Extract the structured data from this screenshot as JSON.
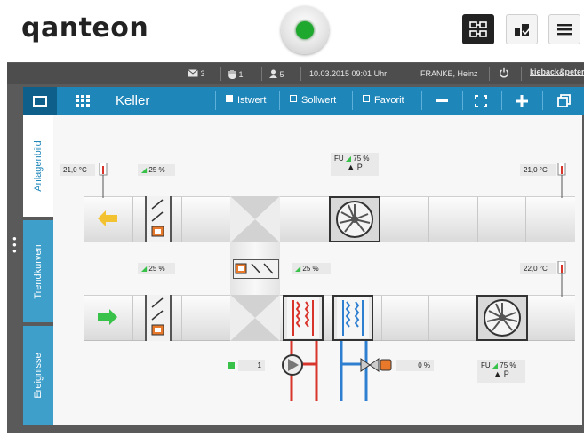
{
  "header": {
    "logo": "qanteon",
    "buttons": [
      "schematic-icon",
      "building-icon",
      "menu-icon"
    ]
  },
  "statusbar": {
    "messages": "3",
    "hands": "1",
    "users": "5",
    "datetime": "10.03.2015 09:01 Uhr",
    "user": "FRANKE, Heinz",
    "brand": "kieback&peter"
  },
  "toolbar": {
    "title": "Keller",
    "istwert": "Istwert",
    "sollwert": "Sollwert",
    "favorit": "Favorit"
  },
  "tabs": {
    "anlagenbild": "Anlagenbild",
    "trendkurven": "Trendkurven",
    "ereignisse": "Ereignisse"
  },
  "values": {
    "temp_top_left": "21,0 °C",
    "damper_top": "25 %",
    "fu_top_label": "FU",
    "fu_top_value": "75 %",
    "fu_top_mode": "▲ P",
    "temp_top_right": "21,0 °C",
    "damper_bottom": "25 %",
    "bypass_damper": "25 %",
    "temp_bottom_right": "22,0 °C",
    "pump_value": "1",
    "valve_value": "0 %",
    "fu_bottom_label": "FU",
    "fu_bottom_value": "75 %",
    "fu_bottom_mode": "▲ P"
  },
  "colors": {
    "accent": "#1f86b9",
    "status_ok": "#1fa82e",
    "heating": "#d9342b",
    "cooling": "#2f7fd1",
    "exhaust_arrow": "#f2c230",
    "supply_arrow": "#39c24a"
  }
}
